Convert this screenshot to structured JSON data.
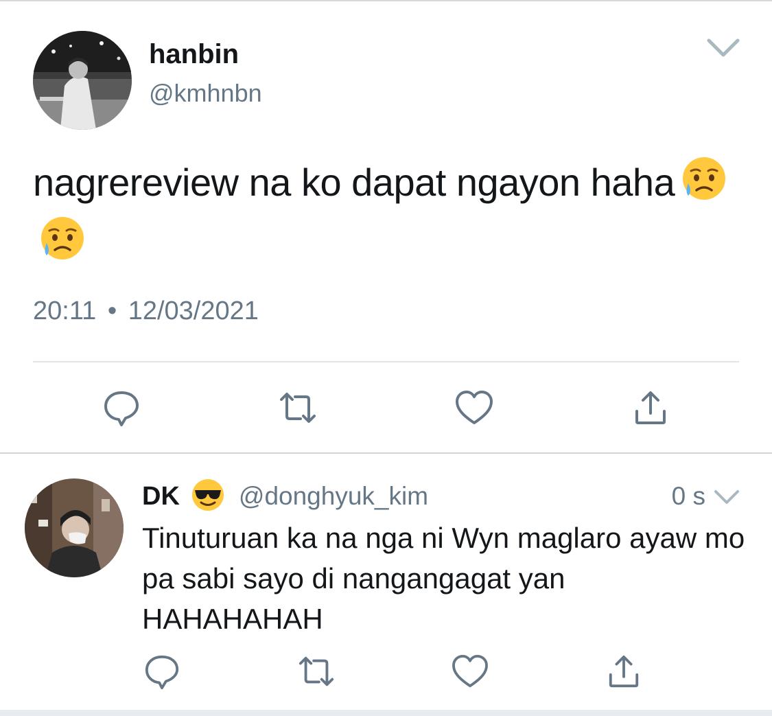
{
  "main_tweet": {
    "display_name": "hanbin",
    "handle": "@kmhnbn",
    "text": "nagrereview na ko dapat ngayon haha",
    "emojis": [
      "sad-but-relieved-face-emoji",
      "sad-but-relieved-face-emoji"
    ],
    "time": "20:11",
    "separator": "•",
    "date": "12/03/2021",
    "actions": [
      "reply-icon",
      "retweet-icon",
      "like-icon",
      "share-icon"
    ]
  },
  "reply_tweet": {
    "display_name": "DK",
    "name_emoji": "smiling-face-with-sunglasses-emoji",
    "handle": "@donghyuk_kim",
    "time_ago": "0 s",
    "text": "Tinuturuan ka na nga ni Wyn maglaro ayaw mo pa sabi sayo di nangangagat yan HAHAHAHAH",
    "actions": [
      "reply-icon",
      "retweet-icon",
      "like-icon",
      "share-icon"
    ]
  },
  "colors": {
    "text_primary": "#14171a",
    "text_secondary": "#657786",
    "icon": "#657786",
    "divider": "#e1e5e8"
  }
}
